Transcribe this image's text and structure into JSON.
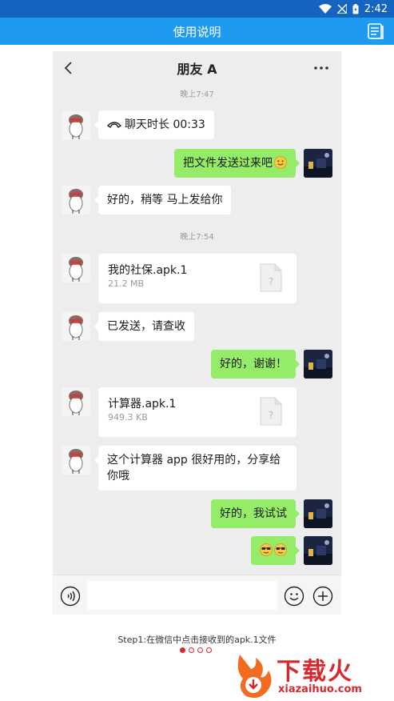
{
  "status_bar": {
    "time": "2:42"
  },
  "app_bar": {
    "title": "使用说明"
  },
  "chat": {
    "contact_name": "朋友 A",
    "messages": [
      {
        "type": "timestamp",
        "text": "晚上7:47"
      },
      {
        "type": "call",
        "side": "left",
        "text": "聊天时长 00:33"
      },
      {
        "type": "text",
        "side": "right",
        "text": "把文件发送过来吧"
      },
      {
        "type": "text",
        "side": "left",
        "text": "好的，稍等 马上发给你"
      },
      {
        "type": "timestamp",
        "text": "晚上7:54"
      },
      {
        "type": "file",
        "side": "left",
        "name": "我的社保.apk.1",
        "size": "21.2 MB"
      },
      {
        "type": "text",
        "side": "left",
        "text": "已发送，请查收"
      },
      {
        "type": "text",
        "side": "right",
        "text": "好的，谢谢！"
      },
      {
        "type": "file",
        "side": "left",
        "name": "计算器.apk.1",
        "size": "949.3 KB"
      },
      {
        "type": "text",
        "side": "left",
        "text": "这个计算器 app 很好用的，分享给你哦"
      },
      {
        "type": "text",
        "side": "right",
        "text": "好的，我试试"
      },
      {
        "type": "emoji",
        "side": "right",
        "text": ""
      }
    ],
    "input": {
      "placeholder": "",
      "value": ""
    }
  },
  "guide": {
    "step_text": "Step1:在微信中点击接收到的apk.1文件",
    "pages": 4,
    "active_page": 1
  },
  "watermark": {
    "brand": "下载火",
    "domain": "xiazaihuo.com"
  },
  "colors": {
    "status_bar": "#1565C0",
    "app_bar": "#1E9BF0",
    "chat_bg": "#EDEDED",
    "my_bubble": "#95EC69",
    "friend_bubble": "#FFFFFF",
    "accent": "#D8282F"
  },
  "icons": {
    "status": [
      "wifi-icon",
      "signal-icon",
      "battery-icon"
    ],
    "app_bar": "manual-icon",
    "chat_header": [
      "back-arrow-icon",
      "more-icon"
    ],
    "input_bar": [
      "voice-icon",
      "emoji-icon",
      "plus-icon"
    ]
  }
}
